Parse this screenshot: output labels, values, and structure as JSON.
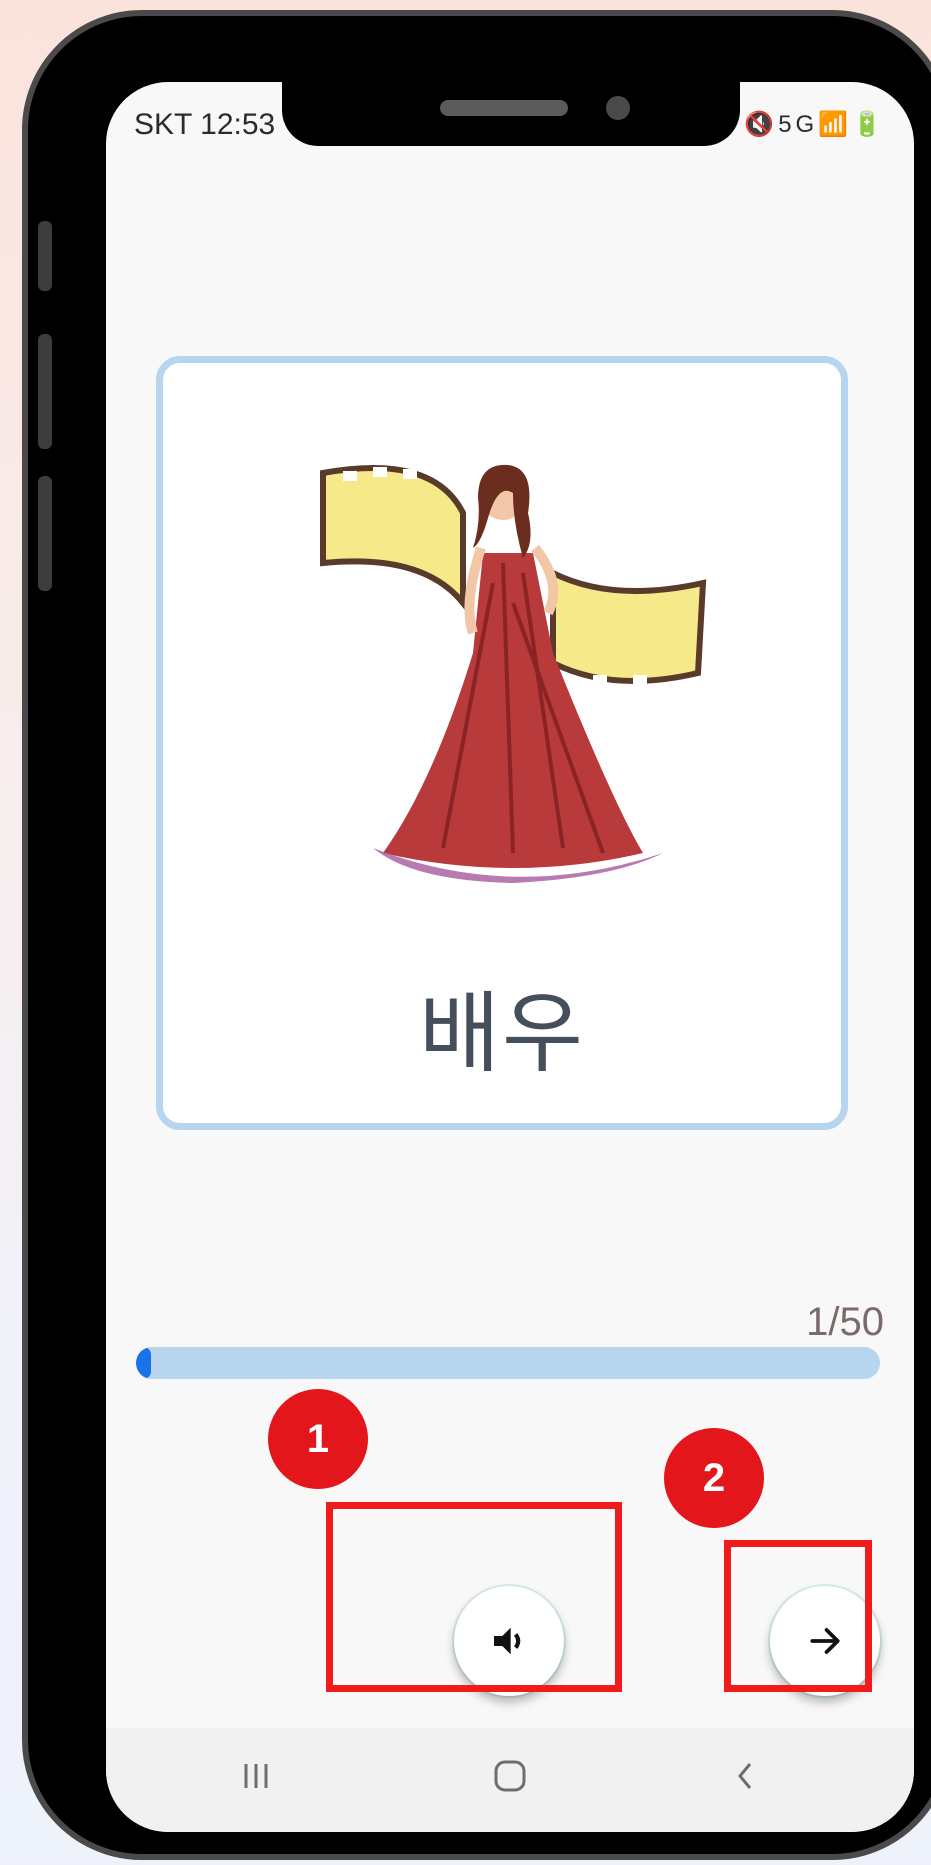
{
  "status_bar": {
    "carrier_time": "SKT 12:53",
    "icons": [
      "mute-icon",
      "5g-icon",
      "signal-icon",
      "battery-icon"
    ]
  },
  "flashcard": {
    "word": "배우",
    "image": "actress-with-film-reel"
  },
  "progress": {
    "counter": "1/50",
    "fraction": 0.02
  },
  "controls": {
    "sound_button": "speaker-icon",
    "next_button": "arrow-right-icon"
  },
  "annotations": {
    "badge_1": "1",
    "badge_2": "2"
  },
  "navbar": {
    "items": [
      "recent-apps-icon",
      "home-icon",
      "back-icon"
    ]
  },
  "colors": {
    "card_border": "#b8d5f0",
    "progress_track": "#b8d5f0",
    "progress_fill": "#1a73e8",
    "annotation_red": "#e3161c"
  }
}
